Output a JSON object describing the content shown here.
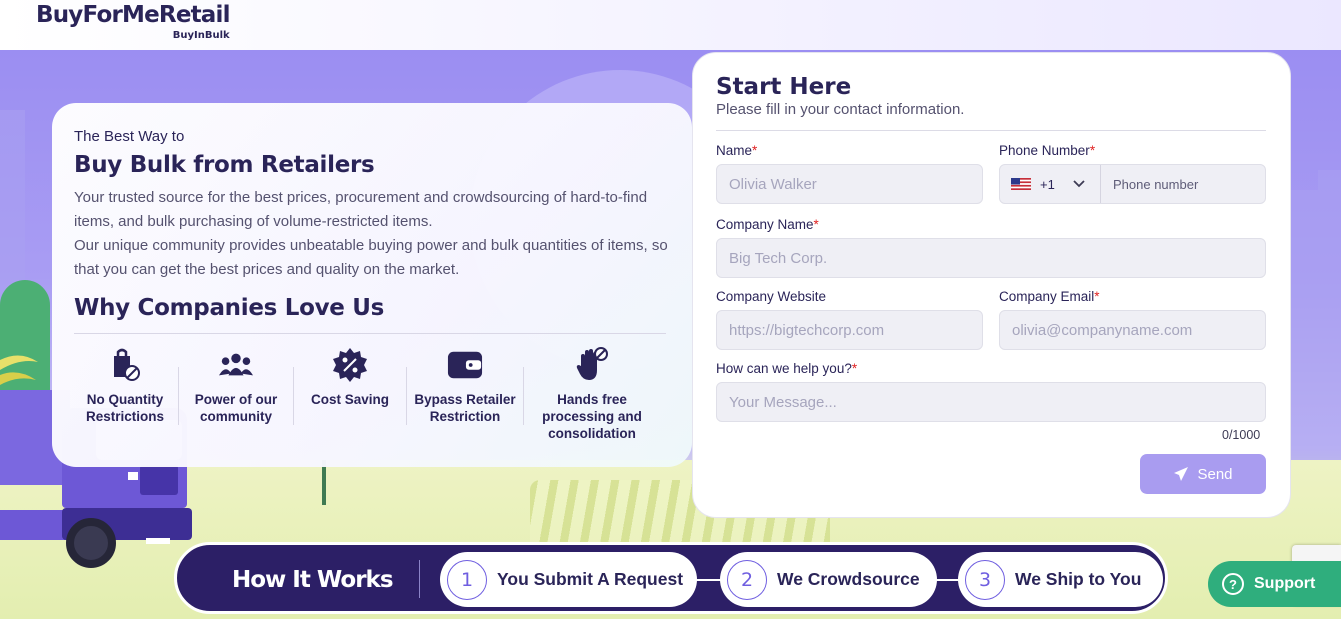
{
  "header": {
    "brand": "BuyForMeRetail",
    "brand_sub": "BuyInBulk"
  },
  "intro": {
    "kicker": "The Best Way to",
    "headline": "Buy Bulk from Retailers",
    "description_1": "Your trusted source for the best prices, procurement and crowdsourcing of hard-to-find items, and bulk purchasing of volume-restricted items.",
    "description_2": "Our unique community provides unbeatable buying power and bulk quantities of items, so that you can get the best prices and quality on the market.",
    "why_title": "Why Companies Love Us",
    "features": [
      {
        "label": "No Quantity Restrictions",
        "icon": "bag-no-limit-icon"
      },
      {
        "label": "Power of our community",
        "icon": "community-icon"
      },
      {
        "label": "Cost Saving",
        "icon": "discount-badge-icon"
      },
      {
        "label": "Bypass Retailer Restriction",
        "icon": "wallet-icon"
      },
      {
        "label": "Hands free processing and consolidation",
        "icon": "hand-icon"
      }
    ]
  },
  "form": {
    "title": "Start Here",
    "subtitle": "Please fill in your contact information.",
    "name_label": "Name",
    "name_placeholder": "Olivia Walker",
    "phone_label": "Phone Number",
    "phone_country_code": "+1",
    "phone_placeholder": "Phone number",
    "company_label": "Company Name",
    "company_placeholder": "Big Tech Corp.",
    "website_label": "Company Website",
    "website_placeholder": "https://bigtechcorp.com",
    "email_label": "Company Email",
    "email_placeholder": "olivia@companyname.com",
    "message_label": "How can we help you?",
    "message_placeholder": "Your Message...",
    "counter": "0/1000",
    "send_label": "Send",
    "required_mark": "*"
  },
  "how_it_works": {
    "title": "How It Works",
    "steps": [
      {
        "num": "1",
        "label": "You Submit A Request"
      },
      {
        "num": "2",
        "label": "We Crowdsource"
      },
      {
        "num": "3",
        "label": "We Ship to You"
      }
    ]
  },
  "support": {
    "label": "Support"
  },
  "colors": {
    "primary": "#2a2458",
    "accent": "#6f5ee0",
    "send_button": "#a99cf0",
    "support": "#2fae7d",
    "required": "#e02222"
  }
}
